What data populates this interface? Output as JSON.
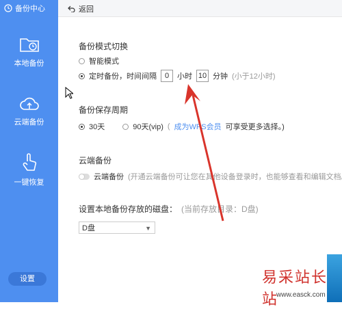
{
  "sidebar": {
    "title": "备份中心",
    "items": [
      {
        "label": "本地备份",
        "icon": "folder-clock-icon"
      },
      {
        "label": "云端备份",
        "icon": "cloud-upload-icon"
      },
      {
        "label": "一键恢复",
        "icon": "hand-pointer-icon"
      }
    ],
    "settings_label": "设置"
  },
  "topbar": {
    "back_label": "返回"
  },
  "mode": {
    "title": "备份模式切换",
    "smart_label": "智能模式",
    "timed_label": "定时备份，时间间隔",
    "hours_value": "0",
    "hours_unit": "小时",
    "minutes_value": "10",
    "minutes_unit": "分钟",
    "hint": "(小于12小时)"
  },
  "retention": {
    "title": "备份保存周期",
    "opt1": "30天",
    "opt2": "90天(vip)",
    "note_open": "(",
    "note_link": "成为WPS会员",
    "note_tail": "可享受更多选择。)"
  },
  "cloud": {
    "title": "云端备份",
    "toggle_label": "云端备份",
    "desc": "(开通云端备份可让您在其他设备登录时，也能够查看和编辑文档。"
  },
  "disk": {
    "title": "设置本地备份存放的磁盘：",
    "current": "(当前存放目录：D盘)",
    "selected": "D盘"
  },
  "watermark": {
    "text": "易采站长站",
    "url": "www.easck.com"
  },
  "colors": {
    "sidebar": "#4e8ff0",
    "arrow": "#d9342b"
  }
}
